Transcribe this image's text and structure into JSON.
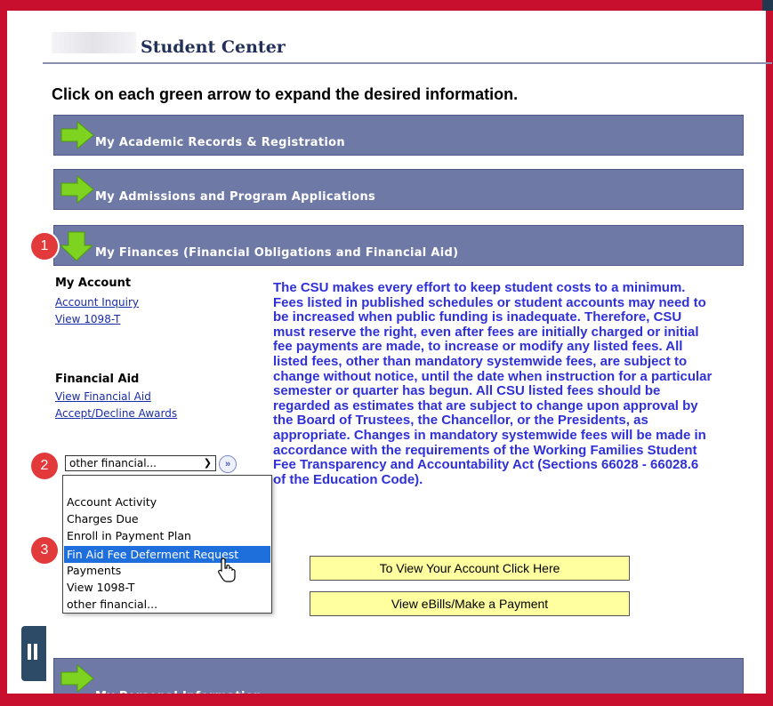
{
  "header": {
    "title": "Student Center"
  },
  "instruction": "Click on each green arrow to expand the desired information.",
  "sections": [
    {
      "label": "My Academic Records & Registration"
    },
    {
      "label": "My Admissions and Program Applications"
    },
    {
      "label": "My Finances (Financial Obligations and Financial Aid)"
    },
    {
      "label": "My Personal Information"
    }
  ],
  "my_account": {
    "heading": "My Account",
    "links": [
      "Account Inquiry",
      "View 1098-T"
    ]
  },
  "financial_aid": {
    "heading": "Financial Aid",
    "links": [
      "View Financial Aid",
      "Accept/Decline Awards"
    ]
  },
  "select": {
    "value": "other financial..."
  },
  "dropdown_options": [
    "Account Activity",
    "Charges Due",
    "Enroll in Payment Plan",
    "Fin Aid Fee Deferment Request",
    "Payments",
    "View 1098-T",
    "other financial..."
  ],
  "selected_option": "Fin Aid Fee Deferment Request",
  "paragraph": "The CSU makes every effort to keep student costs to a minimum. Fees listed in published schedules or student accounts may need to be increased when public funding is inadequate. Therefore, CSU must reserve the right, even after fees are initially charged or initial fee payments are made, to increase or modify any listed fees. All listed fees, other than mandatory systemwide fees, are subject to change without notice, until the date when instruction for a particular semester or quarter has begun. All CSU listed fees should be regarded as estimates that are subject to change upon approval by the Board of Trustees, the Chancellor, or the Presidents, as appropriate. Changes in mandatory systemwide fees will be made in accordance with the requirements of the Working Families Student Fee Transparency and Accountability Act (Sections 66028 - 66028.6 of the Education Code).",
  "buttons": {
    "view_account": "To View Your Account Click Here",
    "ebills": "View eBills/Make a Payment"
  },
  "steps": [
    "1",
    "2",
    "3"
  ],
  "colors": {
    "frame": "#c8102e",
    "bar": "#6e79a5",
    "arrow": "#7ed321",
    "highlight": "#1e6fdc",
    "paragraph": "#3030d8",
    "button": "#ffffa0",
    "badge": "#e23a3a"
  },
  "icons": {
    "expand": "green-right-arrow-icon",
    "expanded": "green-down-arrow-icon",
    "go": "double-chevron-right-icon",
    "pointer": "mouse-pointer-icon",
    "pause": "pause-icon"
  }
}
